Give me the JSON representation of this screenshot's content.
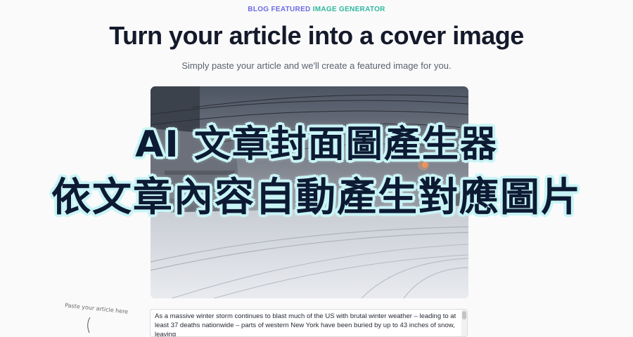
{
  "header": {
    "eyebrow_part1": "BLOG FEATURED ",
    "eyebrow_part2": "IMAGE GENERATOR",
    "title": "Turn your article into a cover image",
    "subtitle": "Simply paste your article and we'll create a featured image for you."
  },
  "generated_image": {
    "icon": "snowy-street-photo"
  },
  "overlay_banner": {
    "line1": "AI 文章封面圖產生器",
    "line2": "依文章內容自動產生對應圖片"
  },
  "hint": {
    "text": "Paste your article here"
  },
  "article_input": {
    "value": "As a massive winter storm continues to blast much of the US with brutal winter weather – leading to at least 37 deaths nationwide – parts of western New York have been buried by up to 43 inches of snow, leaving"
  },
  "colors": {
    "eyebrow_purple": "#6c6ae6",
    "eyebrow_teal": "#2fb8a0",
    "title": "#141a2b",
    "banner_text": "#0d1a33",
    "banner_outline": "#c9f4f6"
  }
}
